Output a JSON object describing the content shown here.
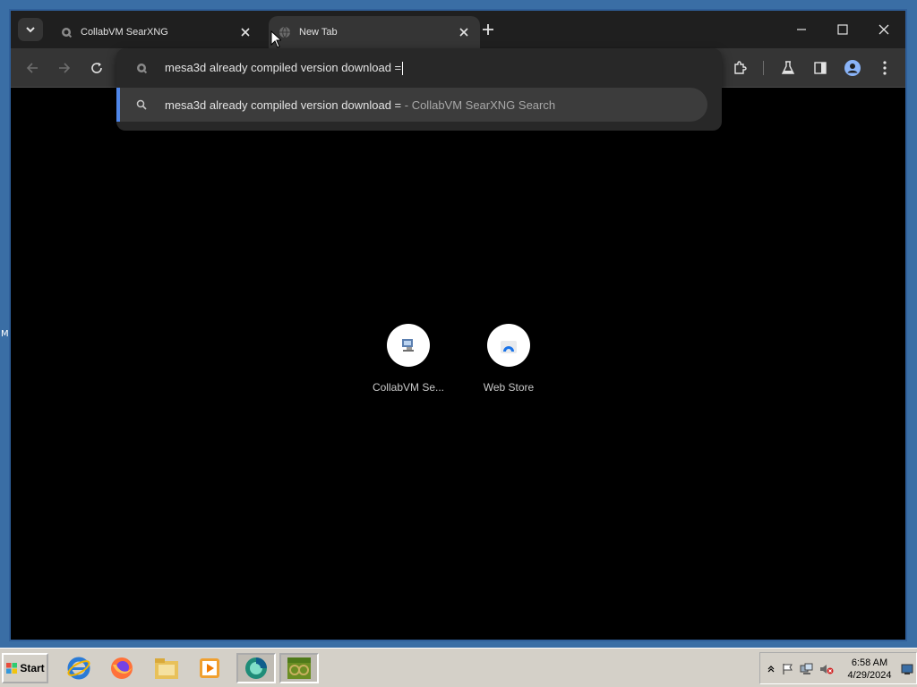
{
  "desktop": {
    "edge_text": "M"
  },
  "browser": {
    "tabs": [
      {
        "title": "CollabVM SearXNG",
        "icon": "searxng-icon",
        "active": false
      },
      {
        "title": "New Tab",
        "icon": "globe-icon",
        "active": true
      }
    ],
    "omnibox": {
      "text": "mesa3d already compiled version download =",
      "suggestion": {
        "query": "mesa3d already compiled version download =",
        "suffix": " - CollabVM SearXNG Search"
      }
    },
    "shortcuts": [
      {
        "label": "CollabVM Se...",
        "icon": "collabvm-icon"
      },
      {
        "label": "Web Store",
        "icon": "web-store-icon"
      }
    ],
    "colors": {
      "accent": "#4f86e8",
      "surface": "#353535",
      "background": "#000000"
    }
  },
  "taskbar": {
    "start_label": "Start",
    "apps": [
      "internet-explorer-icon",
      "firefox-icon",
      "file-explorer-icon",
      "media-player-icon",
      "browser-icon",
      "minecraft-icon"
    ],
    "clock_time": "6:58 AM",
    "clock_date": "4/29/2024"
  }
}
